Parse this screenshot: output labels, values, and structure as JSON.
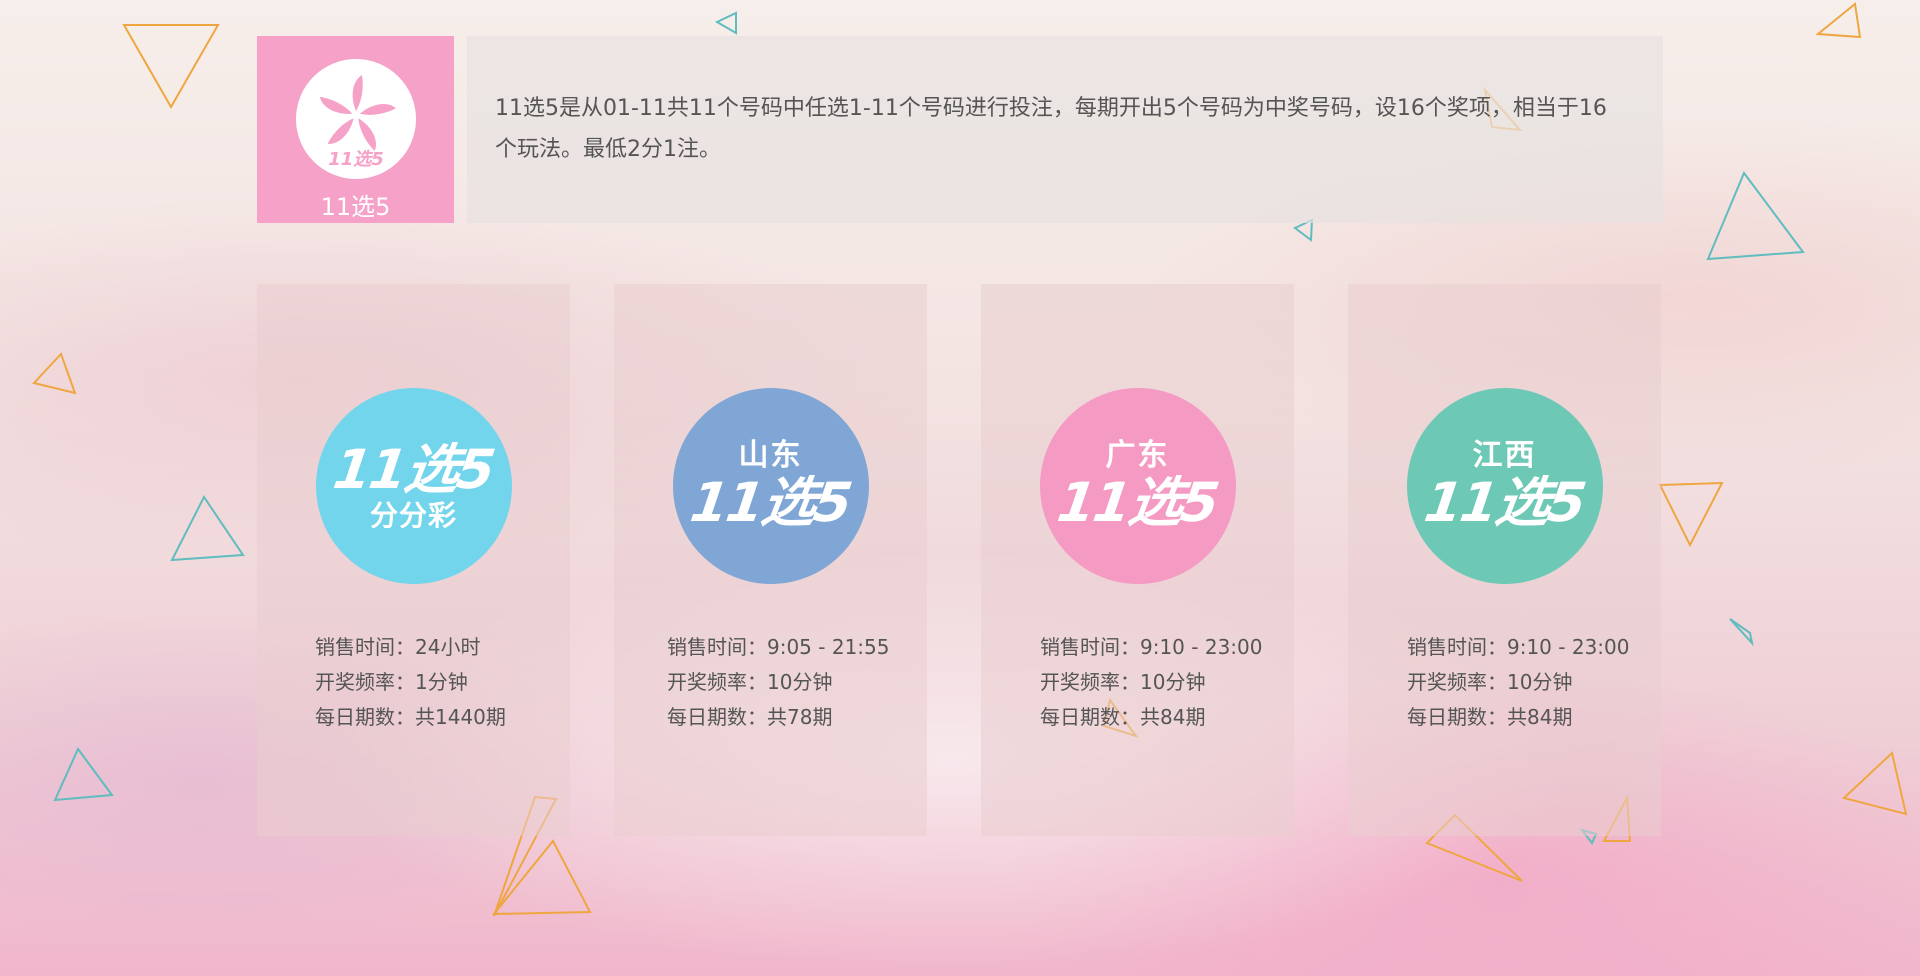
{
  "intro": {
    "logo_title": "11选5",
    "logo_caption": "11选5",
    "description": "11选5是从01-11共11个号码中任选1-11个号码进行投注，每期开出5个号码为中奖号码，设16个奖项，相当于16个玩法。最低2分1注。",
    "accent_color": "#f5a1c8"
  },
  "cards": [
    {
      "badge_color": "#72d5ec",
      "badge_region": "",
      "badge_brand": "11选5",
      "badge_sub": "分分彩",
      "sale_time": "销售时间：24小时",
      "frequency": "开奖频率：1分钟",
      "daily_draws": "每日期数：共1440期"
    },
    {
      "badge_color": "#7fa6d5",
      "badge_region": "山东",
      "badge_brand": "11选5",
      "badge_sub": "",
      "sale_time": "销售时间：9:05 - 21:55",
      "frequency": "开奖频率：10分钟",
      "daily_draws": "每日期数：共78期"
    },
    {
      "badge_color": "#f59ac3",
      "badge_region": "广东",
      "badge_brand": "11选5",
      "badge_sub": "",
      "sale_time": "销售时间：9:10 - 23:00",
      "frequency": "开奖频率：10分钟",
      "daily_draws": "每日期数：共84期"
    },
    {
      "badge_color": "#6ec8b6",
      "badge_region": "江西",
      "badge_brand": "11选5",
      "badge_sub": "",
      "sale_time": "销售时间：9:10 - 23:00",
      "frequency": "开奖频率：10分钟",
      "daily_draws": "每日期数：共84期"
    }
  ],
  "decor_colors": {
    "orange": "#f0a640",
    "teal": "#5fbcbf"
  }
}
